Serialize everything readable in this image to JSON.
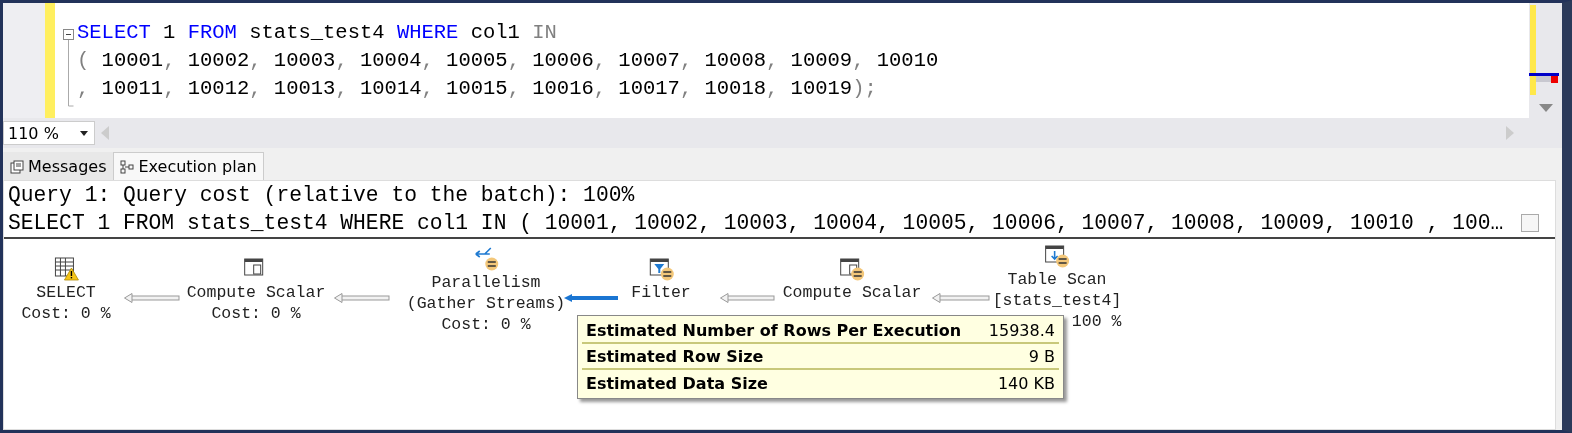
{
  "editor": {
    "lines": [
      [
        {
          "kind": "keyword",
          "text": "SELECT"
        },
        {
          "kind": "plain",
          "text": " 1 "
        },
        {
          "kind": "keyword",
          "text": "FROM"
        },
        {
          "kind": "plain",
          "text": " stats_test4 "
        },
        {
          "kind": "keyword",
          "text": "WHERE"
        },
        {
          "kind": "plain",
          "text": " col1 "
        },
        {
          "kind": "operator",
          "text": "IN"
        }
      ],
      [
        {
          "kind": "operator",
          "text": "("
        },
        {
          "kind": "plain",
          "text": " 10001"
        },
        {
          "kind": "operator",
          "text": ","
        },
        {
          "kind": "plain",
          "text": " 10002"
        },
        {
          "kind": "operator",
          "text": ","
        },
        {
          "kind": "plain",
          "text": " 10003"
        },
        {
          "kind": "operator",
          "text": ","
        },
        {
          "kind": "plain",
          "text": " 10004"
        },
        {
          "kind": "operator",
          "text": ","
        },
        {
          "kind": "plain",
          "text": " 10005"
        },
        {
          "kind": "operator",
          "text": ","
        },
        {
          "kind": "plain",
          "text": " 10006"
        },
        {
          "kind": "operator",
          "text": ","
        },
        {
          "kind": "plain",
          "text": " 10007"
        },
        {
          "kind": "operator",
          "text": ","
        },
        {
          "kind": "plain",
          "text": " 10008"
        },
        {
          "kind": "operator",
          "text": ","
        },
        {
          "kind": "plain",
          "text": " 10009"
        },
        {
          "kind": "operator",
          "text": ","
        },
        {
          "kind": "plain",
          "text": " 10010"
        }
      ],
      [
        {
          "kind": "operator",
          "text": ","
        },
        {
          "kind": "plain",
          "text": " 10011"
        },
        {
          "kind": "operator",
          "text": ","
        },
        {
          "kind": "plain",
          "text": " 10012"
        },
        {
          "kind": "operator",
          "text": ","
        },
        {
          "kind": "plain",
          "text": " 10013"
        },
        {
          "kind": "operator",
          "text": ","
        },
        {
          "kind": "plain",
          "text": " 10014"
        },
        {
          "kind": "operator",
          "text": ","
        },
        {
          "kind": "plain",
          "text": " 10015"
        },
        {
          "kind": "operator",
          "text": ","
        },
        {
          "kind": "plain",
          "text": " 10016"
        },
        {
          "kind": "operator",
          "text": ","
        },
        {
          "kind": "plain",
          "text": " 10017"
        },
        {
          "kind": "operator",
          "text": ","
        },
        {
          "kind": "plain",
          "text": " 10018"
        },
        {
          "kind": "operator",
          "text": ","
        },
        {
          "kind": "plain",
          "text": " 10019"
        },
        {
          "kind": "operator",
          "text": ");"
        }
      ]
    ]
  },
  "zoom": {
    "value": "110 %"
  },
  "tabs": [
    {
      "label": "Messages",
      "selected": false
    },
    {
      "label": "Execution plan",
      "selected": true
    }
  ],
  "results": {
    "header": "Query 1: Query cost (relative to the batch): 100%",
    "query": "SELECT 1 FROM stats_test4 WHERE col1 IN ( 10001, 10002, 10003, 10004, 10005, 10006, 10007, 10008, 10009, 10010 , 100…"
  },
  "plan": {
    "nodes": [
      {
        "label": "SELECT",
        "cost": "Cost: 0 %"
      },
      {
        "label": "Compute Scalar",
        "cost": "Cost: 0 %"
      },
      {
        "label": "Parallelism",
        "subtitle": "(Gather Streams)",
        "cost": "Cost: 0 %"
      },
      {
        "label": "Filter"
      },
      {
        "label": "Compute Scalar"
      },
      {
        "label": "Table Scan",
        "subtitle": "[stats_test4]",
        "cost": "100 %"
      }
    ],
    "arrows": [
      {
        "kind": "thin"
      },
      {
        "kind": "thin"
      },
      {
        "kind": "thick"
      },
      {
        "kind": "thin"
      },
      {
        "kind": "thin"
      }
    ],
    "tooltip": [
      {
        "label": "Estimated Number of Rows Per Execution",
        "value": "15938.4"
      },
      {
        "label": "Estimated Row Size",
        "value": "9 B"
      },
      {
        "label": "Estimated Data Size",
        "value": "140 KB"
      }
    ]
  }
}
